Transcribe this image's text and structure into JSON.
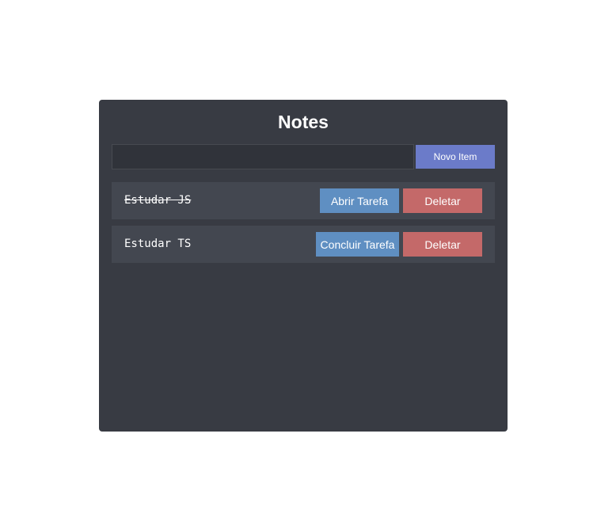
{
  "app": {
    "title": "Notes"
  },
  "form": {
    "input_value": "",
    "input_placeholder": "",
    "add_label": "Novo Item"
  },
  "items": [
    {
      "text": "Estudar JS",
      "done": true,
      "toggle_label": "Abrir Tarefa",
      "delete_label": "Deletar"
    },
    {
      "text": "Estudar TS",
      "done": false,
      "toggle_label": "Concluir Tarefa",
      "delete_label": "Deletar"
    }
  ],
  "colors": {
    "panel_bg": "#383b43",
    "item_bg": "#434750",
    "add_button": "#6b7bc9",
    "toggle_button": "#5f8fc2",
    "delete_button": "#c46969"
  }
}
